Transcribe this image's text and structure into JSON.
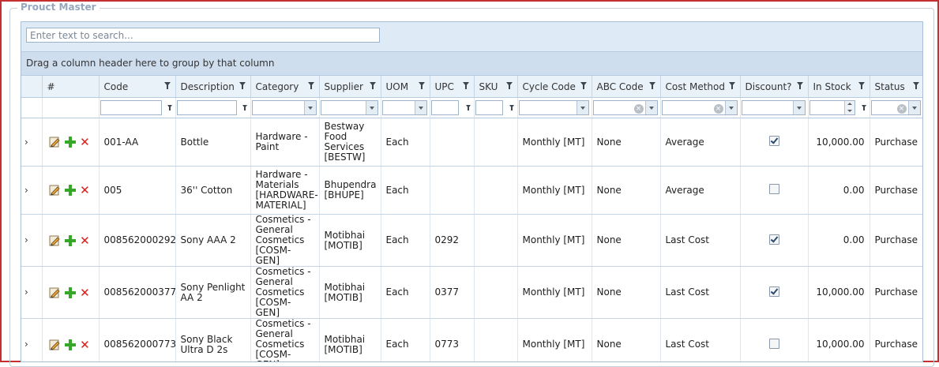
{
  "panel": {
    "title": "Prouct Master"
  },
  "search": {
    "placeholder": "Enter text to search..."
  },
  "group_panel": {
    "text": "Drag a column header here to group by that column"
  },
  "columns": [
    "",
    "#",
    "Code",
    "Description",
    "Category",
    "Supplier",
    "UOM",
    "UPC",
    "SKU",
    "Cycle Code",
    "ABC Code",
    "Cost Method",
    "Discount?",
    "In Stock",
    "Status"
  ],
  "rows": [
    {
      "code": "001-AA",
      "description": "Bottle",
      "category": "Hardware - Paint",
      "supplier": "Bestway Food Services [BESTW]",
      "uom": "Each",
      "upc": "",
      "sku": "",
      "cycle_code": "Monthly [MT]",
      "abc_code": "None",
      "cost_method": "Average",
      "discount": true,
      "in_stock": "10,000.00",
      "status": "Purchase"
    },
    {
      "code": "005",
      "description": "36'' Cotton",
      "category": "Hardware - Materials [HARDWARE-MATERIAL]",
      "supplier": "Bhupendra [BHUPE]",
      "uom": "Each",
      "upc": "",
      "sku": "",
      "cycle_code": "Monthly [MT]",
      "abc_code": "None",
      "cost_method": "Average",
      "discount": false,
      "in_stock": "0.00",
      "status": "Purchase"
    },
    {
      "code": "008562000292",
      "description": "Sony AAA 2",
      "category": "Cosmetics - General Cosmetics [COSM-GEN]",
      "supplier": "Motibhai [MOTIB]",
      "uom": "Each",
      "upc": "0292",
      "sku": "",
      "cycle_code": "Monthly [MT]",
      "abc_code": "None",
      "cost_method": "Last Cost",
      "discount": true,
      "in_stock": "0.00",
      "status": "Purchase"
    },
    {
      "code": "008562000377",
      "description": "Sony Penlight AA 2",
      "category": "Cosmetics - General Cosmetics [COSM-GEN]",
      "supplier": "Motibhai [MOTIB]",
      "uom": "Each",
      "upc": "0377",
      "sku": "",
      "cycle_code": "Monthly [MT]",
      "abc_code": "None",
      "cost_method": "Last Cost",
      "discount": true,
      "in_stock": "10,000.00",
      "status": "Purchase"
    },
    {
      "code": "008562000773",
      "description": "Sony Black Ultra D 2s",
      "category": "Cosmetics - General Cosmetics [COSM-GEN]",
      "supplier": "Motibhai [MOTIB]",
      "uom": "Each",
      "upc": "0773",
      "sku": "",
      "cycle_code": "Monthly [MT]",
      "abc_code": "None",
      "cost_method": "Last Cost",
      "discount": false,
      "in_stock": "10,000.00",
      "status": "Purchase"
    }
  ],
  "icons": {
    "expand": "chevron-right-icon",
    "edit": "pencil-edit-icon",
    "add": "plus-icon",
    "delete": "delete-x-icon",
    "filter": "funnel-filter-icon"
  },
  "colors": {
    "frame": "#c62f2f",
    "header_bg": "#e9f1f9",
    "toolbar_bg": "#deebf7",
    "add_green": "#35a828",
    "delete_red": "#d4211c"
  }
}
